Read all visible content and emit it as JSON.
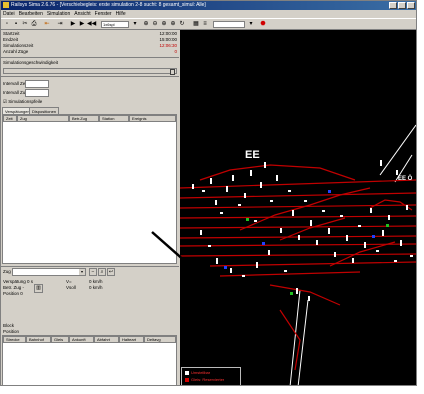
{
  "window": {
    "title": "Railsys Sima 2.6.76 - [Verschiebegleis: erste simulation 2-8 sucht: 8 gesamt_simul: Alle]"
  },
  "menu": {
    "items": [
      "Datei",
      "Bearbeiten",
      "Simulation",
      "Ansicht",
      "Fenster",
      "Hilfe"
    ]
  },
  "toolbar": {
    "speed_value": "1x6spl",
    "layer_value": "",
    "icons": [
      "new-icon",
      "save-icon",
      "cut-icon",
      "print-icon",
      "prev-icon",
      "step-icon",
      "play-icon",
      "pause-icon",
      "stop-icon",
      "zoom-in-icon",
      "zoom-out-icon",
      "zoom-fit-icon",
      "zoom-area-icon",
      "refresh-icon",
      "grid-icon",
      "stop-sign-icon"
    ]
  },
  "status": {
    "rows": [
      {
        "label": "Startzeit",
        "value": "12:00:00"
      },
      {
        "label": "Endzeit",
        "value": "15:00:00"
      },
      {
        "label": "Simulationszeit",
        "value": "12:06:30"
      },
      {
        "label": "Anzahl Züge",
        "value": "0"
      }
    ],
    "speed_label": "Simulationsgeschwindigkeit",
    "interval_label": "Intervall Zeit",
    "interval_train_label": "Intervall Zug",
    "checkbox_label": "Simulationspfeile"
  },
  "tabs": {
    "items": [
      "Verspätungen",
      "Dispositionen"
    ],
    "columns": [
      "Zeit",
      "Zug",
      "Betr.Zug",
      "Station",
      "Ereignis"
    ]
  },
  "train": {
    "label": "Zug",
    "delay_label": "Verspätung",
    "delay_value": "0 s",
    "vmax_label": "V=",
    "vmax_value": "0 km/h",
    "brake_label": "Betr. Zug",
    "brake_value": "-",
    "vsoll_label": "Vsoll",
    "vsoll_value": "0 km/h",
    "position_label": "Position",
    "position_value": "0",
    "block_label": "Block",
    "pos2_label": "Position",
    "columns": [
      "Strecke",
      "Bahnhof",
      "Gleis",
      "Ankunft",
      "Abfahrt",
      "Halteart",
      "Deltavg"
    ]
  },
  "canvas": {
    "label_main": "EE",
    "label_secondary": "EE Ö",
    "colors": {
      "background": "#000000",
      "track": "#c00000",
      "signal": "#ffffff",
      "block_blue": "#2040ff",
      "block_green": "#20c020"
    },
    "legend": [
      {
        "label": "Umstellbar",
        "color": "#ffffff"
      },
      {
        "label": "Gleis: Reservierter",
        "color": "#d00000"
      }
    ]
  }
}
